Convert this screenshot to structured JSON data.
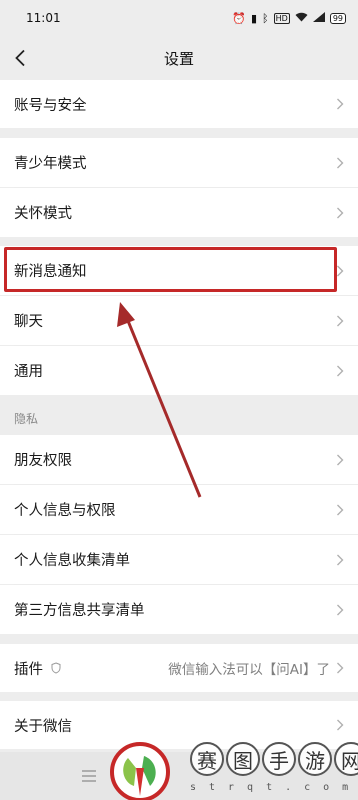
{
  "status_bar": {
    "time": "11:01",
    "battery": "99"
  },
  "nav": {
    "title": "设置"
  },
  "rows": {
    "account": "账号与安全",
    "teen": "青少年模式",
    "care": "关怀模式",
    "notifications": "新消息通知",
    "chat": "聊天",
    "general": "通用",
    "friend_perm": "朋友权限",
    "personal_info_perm": "个人信息与权限",
    "personal_info_list": "个人信息收集清单",
    "third_party_list": "第三方信息共享清单",
    "plugins": "插件",
    "plugins_value": "微信输入法可以【问AI】了",
    "about": "关于微信"
  },
  "sections": {
    "privacy": "隐私"
  },
  "watermark": {
    "chars": [
      "赛",
      "图",
      "手",
      "游",
      "网"
    ],
    "sub": "strqt.com"
  },
  "colors": {
    "highlight": "#c62828",
    "background": "#ededed"
  }
}
